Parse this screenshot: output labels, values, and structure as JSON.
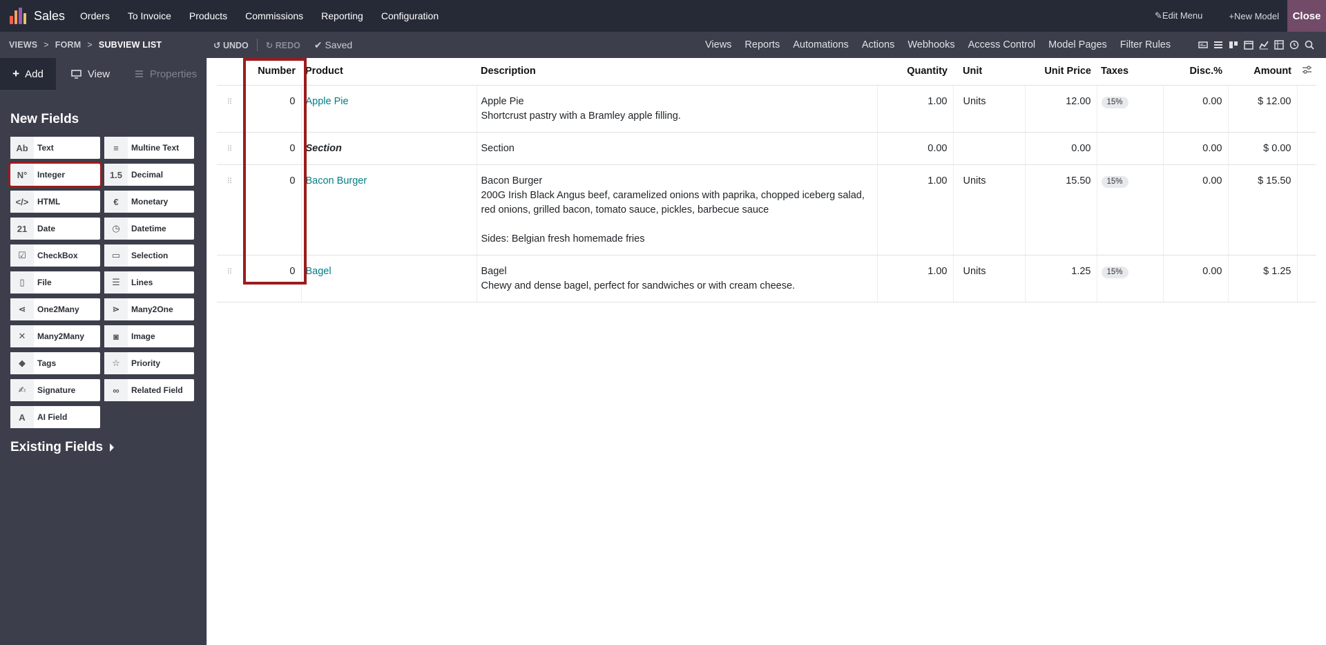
{
  "topbar": {
    "app_name": "Sales",
    "menu": [
      "Orders",
      "To Invoice",
      "Products",
      "Commissions",
      "Reporting",
      "Configuration"
    ],
    "edit_menu": "Edit Menu",
    "new_model": "New Model",
    "close": "Close"
  },
  "subbar": {
    "crumbs": [
      "VIEWS",
      "FORM",
      "SUBVIEW LIST"
    ],
    "undo": "UNDO",
    "redo": "REDO",
    "saved": "Saved",
    "nav": [
      "Views",
      "Reports",
      "Automations",
      "Actions",
      "Webhooks",
      "Access Control",
      "Model Pages",
      "Filter Rules"
    ]
  },
  "sidebar": {
    "tabs": {
      "add": "Add",
      "view": "View",
      "properties": "Properties"
    },
    "new_fields_title": "New Fields",
    "fields": [
      {
        "label": "Text",
        "icon": "text-icon",
        "glyph": "Ab"
      },
      {
        "label": "Multine Text",
        "icon": "multiline-icon",
        "glyph": "≡"
      },
      {
        "label": "Integer",
        "icon": "integer-icon",
        "glyph": "N°"
      },
      {
        "label": "Decimal",
        "icon": "decimal-icon",
        "glyph": "1.5"
      },
      {
        "label": "HTML",
        "icon": "html-icon",
        "glyph": "</>"
      },
      {
        "label": "Monetary",
        "icon": "euro-icon",
        "glyph": "€"
      },
      {
        "label": "Date",
        "icon": "calendar-icon",
        "glyph": "21"
      },
      {
        "label": "Datetime",
        "icon": "datetime-icon",
        "glyph": "◷"
      },
      {
        "label": "CheckBox",
        "icon": "checkbox-icon",
        "glyph": "☑"
      },
      {
        "label": "Selection",
        "icon": "selection-icon",
        "glyph": "▭"
      },
      {
        "label": "File",
        "icon": "file-icon",
        "glyph": "▯"
      },
      {
        "label": "Lines",
        "icon": "lines-icon",
        "glyph": "☰"
      },
      {
        "label": "One2Many",
        "icon": "one2many-icon",
        "glyph": "⋖"
      },
      {
        "label": "Many2One",
        "icon": "many2one-icon",
        "glyph": "⋗"
      },
      {
        "label": "Many2Many",
        "icon": "many2many-icon",
        "glyph": "✕"
      },
      {
        "label": "Image",
        "icon": "camera-icon",
        "glyph": "◙"
      },
      {
        "label": "Tags",
        "icon": "tag-icon",
        "glyph": "◆"
      },
      {
        "label": "Priority",
        "icon": "star-icon",
        "glyph": "☆"
      },
      {
        "label": "Signature",
        "icon": "signature-icon",
        "glyph": "✍"
      },
      {
        "label": "Related Field",
        "icon": "link-icon",
        "glyph": "∞"
      },
      {
        "label": "AI Field",
        "icon": "ai-icon",
        "glyph": "A"
      }
    ],
    "existing_fields_title": "Existing Fields"
  },
  "table": {
    "headers": {
      "number": "Number",
      "product": "Product",
      "description": "Description",
      "quantity": "Quantity",
      "unit": "Unit",
      "unit_price": "Unit Price",
      "taxes": "Taxes",
      "disc": "Disc.%",
      "amount": "Amount"
    },
    "rows": [
      {
        "number": "0",
        "product": "Apple Pie",
        "section": false,
        "description": [
          "Apple Pie",
          "Shortcrust pastry with a Bramley apple filling."
        ],
        "quantity": "1.00",
        "unit": "Units",
        "unit_price": "12.00",
        "taxes": "15%",
        "disc": "0.00",
        "amount": "$ 12.00"
      },
      {
        "number": "0",
        "product": "Section",
        "section": true,
        "description": [
          "Section"
        ],
        "quantity": "0.00",
        "unit": "",
        "unit_price": "0.00",
        "taxes": "",
        "disc": "0.00",
        "amount": "$ 0.00"
      },
      {
        "number": "0",
        "product": "Bacon Burger",
        "section": false,
        "description": [
          "Bacon Burger",
          "200G Irish Black Angus beef, caramelized onions with paprika, chopped iceberg salad,",
          "red onions, grilled bacon, tomato sauce, pickles, barbecue sauce",
          "",
          "Sides: Belgian fresh homemade fries"
        ],
        "quantity": "1.00",
        "unit": "Units",
        "unit_price": "15.50",
        "taxes": "15%",
        "disc": "0.00",
        "amount": "$ 15.50"
      },
      {
        "number": "0",
        "product": "Bagel",
        "section": false,
        "description": [
          "Bagel",
          "Chewy and dense bagel, perfect for sandwiches or with cream cheese."
        ],
        "quantity": "1.00",
        "unit": "Units",
        "unit_price": "1.25",
        "taxes": "15%",
        "disc": "0.00",
        "amount": "$ 1.25"
      }
    ]
  },
  "colors": {
    "topbar": "#262a36",
    "subbar": "#3c3e4b",
    "accent": "#714b67",
    "link": "#017e84",
    "highlight": "#9b1c1c"
  }
}
